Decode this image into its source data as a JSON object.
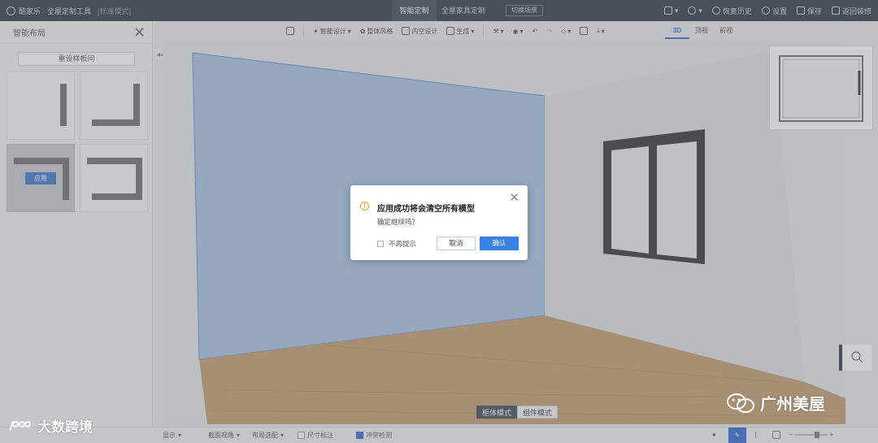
{
  "app": {
    "title": "酷家乐 · 全屋定制工具",
    "mode_label": "[标准模式]"
  },
  "top_tabs": [
    {
      "label": "智能定制",
      "active": true
    },
    {
      "label": "全屋家具定制",
      "active": false
    }
  ],
  "switch_label": "切换场景",
  "top_actions": {
    "restore_history": "恢复历史",
    "settings": "设置",
    "save": "保存",
    "return_design": "返回装修"
  },
  "left_panel": {
    "title": "智能布局",
    "reset_button": "重设样板间",
    "apply_chip": "应用"
  },
  "toolbar": {
    "items": [
      "智能设计",
      "整体风格",
      "内空设计",
      "生成",
      "",
      "",
      "",
      "",
      "",
      ""
    ]
  },
  "view_tabs": [
    {
      "label": "3D",
      "active": true
    },
    {
      "label": "顶视",
      "active": false
    },
    {
      "label": "前视",
      "active": false
    }
  ],
  "bottom_modes": [
    {
      "label": "柜体模式",
      "active": true
    },
    {
      "label": "组件模式",
      "active": false
    }
  ],
  "statusbar": {
    "items": [
      "显示",
      "截面视角",
      "布局选配",
      "尺寸标注",
      "冲突检测"
    ]
  },
  "dialog": {
    "title": "应用成功将会清空所有模型",
    "message": "确定继续吗？",
    "dont_remind": "不再提示",
    "cancel": "取消",
    "confirm": "确认"
  },
  "watermarks": {
    "left": "大数跨境",
    "right": "广州美屋"
  },
  "colors": {
    "accent": "#3a80e6",
    "topbar": "#2b3340",
    "warning": "#f0a020"
  }
}
